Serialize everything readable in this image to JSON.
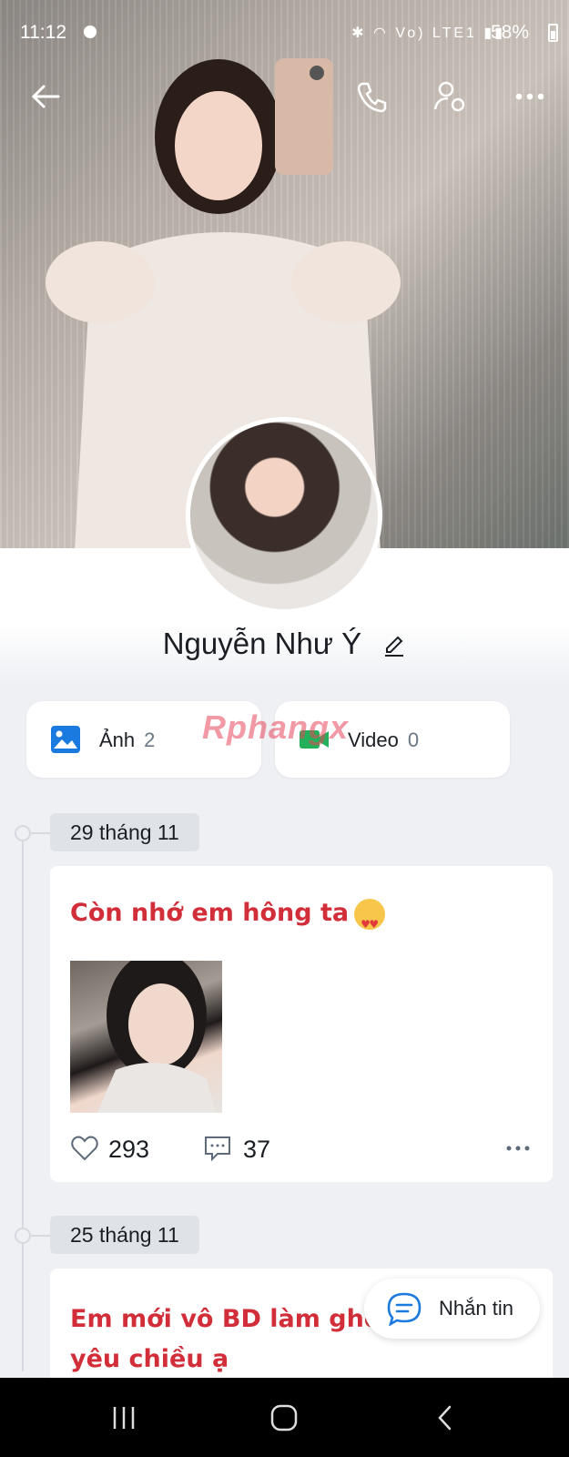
{
  "status_bar": {
    "time": "11:12",
    "signal_text": "Vo) LTE1",
    "battery": "58%"
  },
  "profile": {
    "name": "Nguyễn Như Ý"
  },
  "media": {
    "photos_label": "Ảnh",
    "photos_count": "2",
    "videos_label": "Video",
    "videos_count": "0"
  },
  "watermark": "Rphangx",
  "posts": [
    {
      "date": "29 tháng 11",
      "text": "Còn nhớ em hông ta",
      "likes": "293",
      "comments": "37"
    },
    {
      "date": "25 tháng 11",
      "text_line1": "Em mới vô BD làm ghe",
      "text_line2": "yêu chiều ạ"
    }
  ],
  "message_button": "Nhắn tin",
  "colors": {
    "accent_blue": "#1a7ae0",
    "post_red": "#d12e3a",
    "video_green": "#24b05a"
  }
}
